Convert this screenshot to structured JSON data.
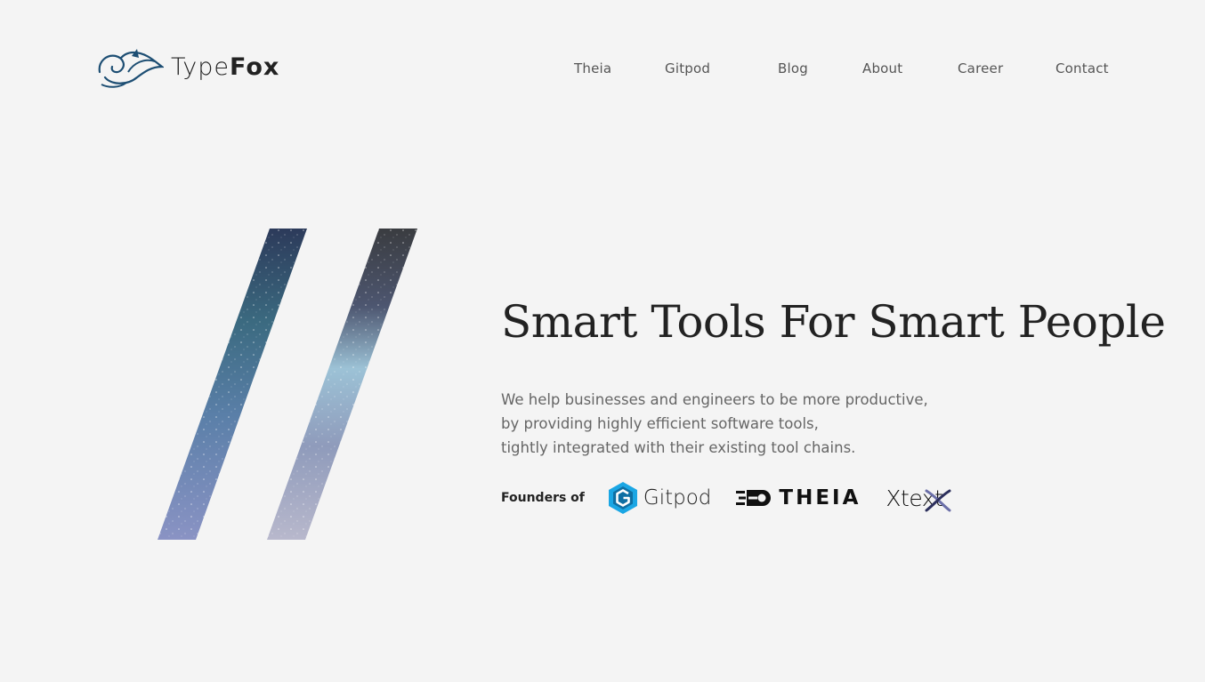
{
  "header": {
    "logo": {
      "light": "Type",
      "bold": "Fox",
      "icon": "fox-logo-icon",
      "color": "#1d4e73"
    },
    "nav": [
      {
        "label": "Theia"
      },
      {
        "label": "Gitpod"
      },
      {
        "label": "Blog"
      },
      {
        "label": "About"
      },
      {
        "label": "Career"
      },
      {
        "label": "Contact"
      }
    ]
  },
  "hero": {
    "title": "Smart Tools For Smart People",
    "body": [
      "We help businesses and engineers to be more productive,",
      "by providing highly efficient software tools,",
      "tightly integrated with their existing tool chains."
    ],
    "founders_label": "Founders of",
    "brands": [
      {
        "name": "Gitpod",
        "icon": "gitpod-icon",
        "color": "#1aa6e4"
      },
      {
        "name": "THEIA",
        "icon": "theia-icon",
        "color": "#111111"
      },
      {
        "name": "Xtext",
        "icon": "xtext-icon",
        "color": "#111111"
      }
    ]
  },
  "colors": {
    "background": "#f4f4f4",
    "text": "#222222",
    "muted_text": "#666666",
    "accent": "#1d4e73"
  }
}
